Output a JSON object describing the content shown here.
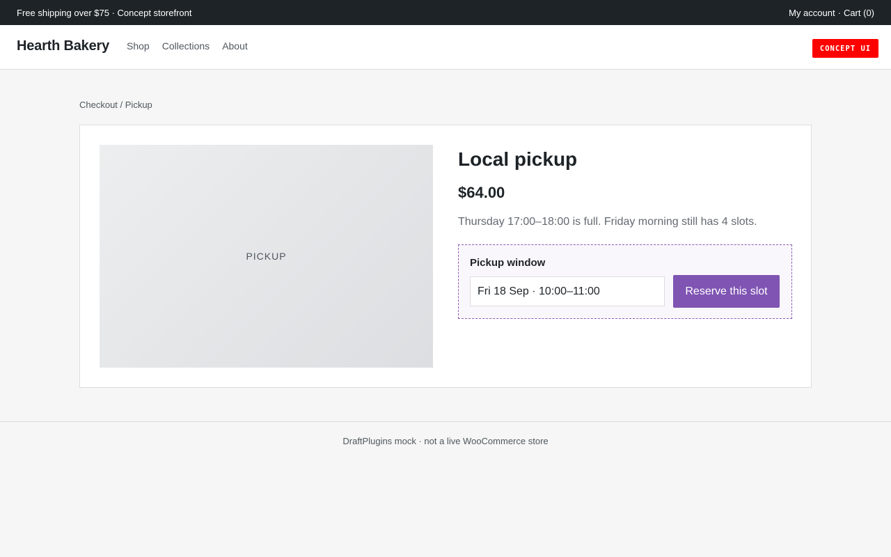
{
  "topbar": {
    "promo_text": "Free shipping over $75 · Concept storefront",
    "my_account_label": "My account",
    "separator": "·",
    "cart_label": "Cart (0)"
  },
  "header": {
    "brand": "Hearth Bakery",
    "nav": [
      {
        "label": "Shop"
      },
      {
        "label": "Collections"
      },
      {
        "label": "About"
      }
    ],
    "badge": "CONCEPT UI"
  },
  "breadcrumb": "Checkout / Pickup",
  "product": {
    "image_label": "PICKUP",
    "title": "Local pickup",
    "price": "$64.00",
    "notice": "Thursday 17:00–18:00 is full. Friday morning still has 4 slots."
  },
  "pickup_form": {
    "label": "Pickup window",
    "selected_value": "Fri 18 Sep · 10:00–11:00",
    "button_label": "Reserve this slot"
  },
  "footer": {
    "text": "DraftPlugins mock · not a live WooCommerce store"
  },
  "colors": {
    "topbar_bg": "#1d2327",
    "accent_purple": "#7f54b3",
    "badge_red": "#ff0000",
    "page_bg": "#f5f6f5"
  }
}
